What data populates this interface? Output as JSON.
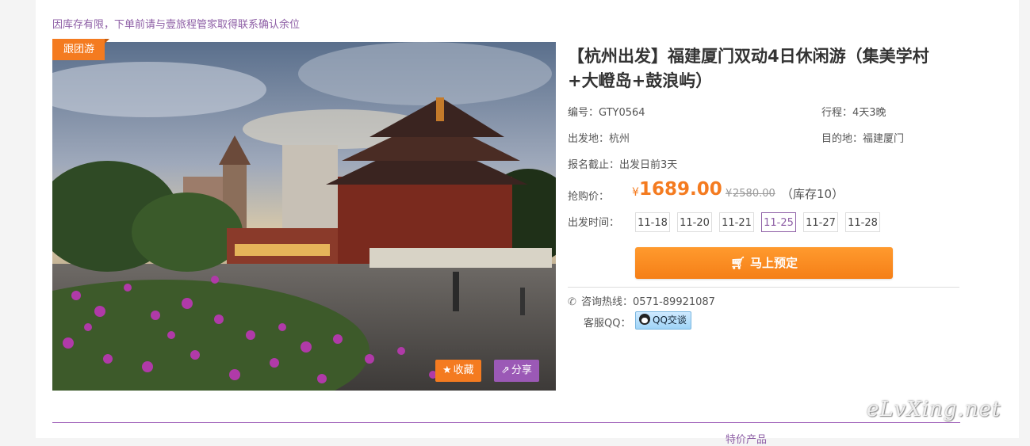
{
  "notice": "因库存有限，下单前请与壹旅程管家取得联系确认余位",
  "badge": "跟团游",
  "photo_actions": {
    "favorite": "收藏",
    "share": "分享"
  },
  "title": "【杭州出发】福建厦门双动4日休闲游（集美学村+大嶝岛+鼓浪屿）",
  "meta": {
    "code": "编号：GTY0564",
    "duration": "行程：4天3晚",
    "departure": "出发地：杭州",
    "destination": "目的地：福建厦门",
    "deadline": "报名截止：出发日前3天"
  },
  "price": {
    "label": "抢购价：",
    "currency": "¥",
    "current": "1689.00",
    "original_currency": "¥",
    "original": "2580.00",
    "stock": "（库存10）"
  },
  "dates": {
    "label": "出发时间：",
    "items": [
      "11-18",
      "11-20",
      "11-21",
      "11-25",
      "11-27",
      "11-28"
    ],
    "selected": "11-25"
  },
  "book_label": "马上预定",
  "hotline": "咨询热线：0571-89921087",
  "qq": {
    "label": "客服QQ：",
    "button": "QQ交谈"
  },
  "bottom_tab": "特价产品",
  "watermark": "eLvXing.net",
  "colors": {
    "accent": "#f47b20",
    "purple": "#9b59b6",
    "notice": "#8e5fa6"
  }
}
